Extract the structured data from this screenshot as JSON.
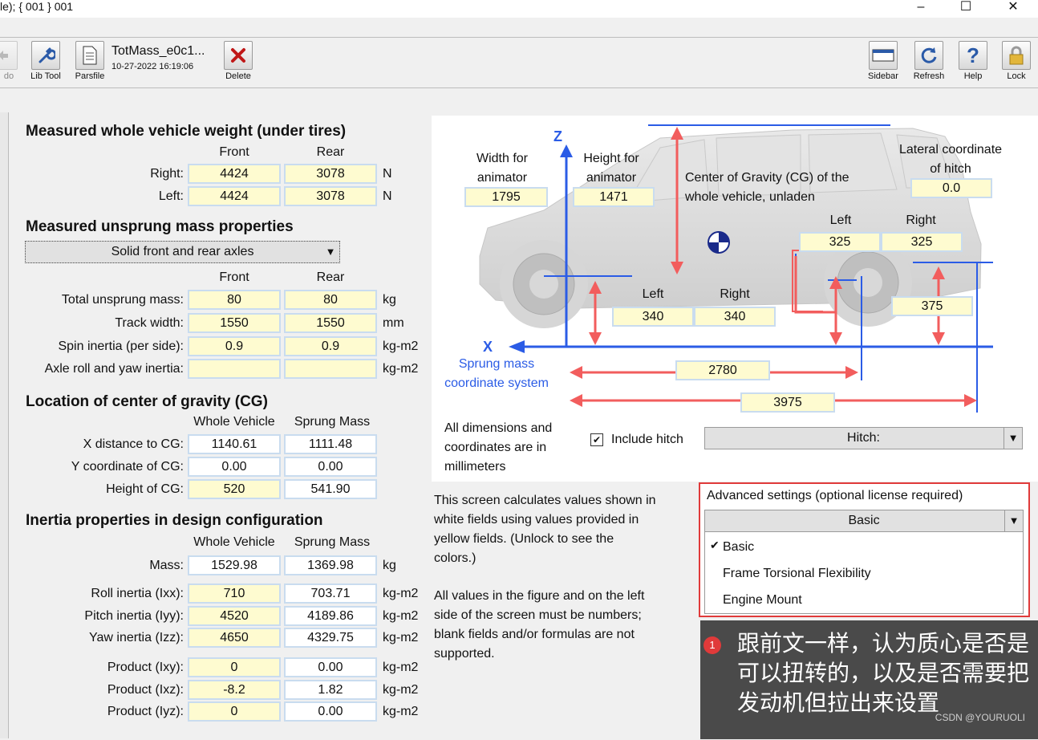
{
  "window": {
    "title": "le); { 001 } 001",
    "controls": [
      "–",
      "☐",
      "✕"
    ]
  },
  "toolbar": {
    "undo_label": "do",
    "lib_tool_label": "Lib Tool",
    "parsfile_label": "Parsfile",
    "dataset_name": "TotMass_e0c1...",
    "dataset_date": "10-27-2022 16:19:06",
    "delete_label": "Delete",
    "sidebar_label": "Sidebar",
    "refresh_label": "Refresh",
    "help_label": "Help",
    "lock_label": "Lock"
  },
  "weight": {
    "title": "Measured whole vehicle weight (under tires)",
    "col_front": "Front",
    "col_rear": "Rear",
    "right_label": "Right:",
    "left_label": "Left:",
    "right_front": "4424",
    "right_rear": "3078",
    "left_front": "4424",
    "left_rear": "3078",
    "unit": "N"
  },
  "unsprung": {
    "title": "Measured unsprung mass properties",
    "axle_option": "Solid front and rear axles",
    "col_front": "Front",
    "col_rear": "Rear",
    "rows": [
      {
        "label": "Total unsprung mass:",
        "front": "80",
        "rear": "80",
        "unit": "kg"
      },
      {
        "label": "Track width:",
        "front": "1550",
        "rear": "1550",
        "unit": "mm"
      },
      {
        "label": "Spin inertia (per side):",
        "front": "0.9",
        "rear": "0.9",
        "unit": "kg-m2"
      },
      {
        "label": "Axle roll and yaw inertia:",
        "front": "",
        "rear": "",
        "unit": "kg-m2"
      }
    ]
  },
  "cg": {
    "title": "Location of center of gravity (CG)",
    "col_whole": "Whole Vehicle",
    "col_sprung": "Sprung Mass",
    "rows": [
      {
        "label": "X distance  to CG:",
        "whole": "1140.61",
        "sprung": "1111.48"
      },
      {
        "label": "Y coordinate of CG:",
        "whole": "0.00",
        "sprung": "0.00"
      },
      {
        "label": "Height of CG:",
        "whole": "520",
        "sprung": "541.90"
      }
    ]
  },
  "inertia": {
    "title": "Inertia properties in design configuration",
    "col_whole": "Whole Vehicle",
    "col_sprung": "Sprung Mass",
    "mass": {
      "label": "Mass:",
      "whole": "1529.98",
      "sprung": "1369.98",
      "unit": "kg"
    },
    "rows1": [
      {
        "label": "Roll inertia (Ixx):",
        "whole": "710",
        "sprung": "703.71",
        "unit": "kg-m2"
      },
      {
        "label": "Pitch inertia (Iyy):",
        "whole": "4520",
        "sprung": "4189.86",
        "unit": "kg-m2"
      },
      {
        "label": "Yaw inertia (Izz):",
        "whole": "4650",
        "sprung": "4329.75",
        "unit": "kg-m2"
      }
    ],
    "rows2": [
      {
        "label": "Product (Ixy):",
        "whole": "0",
        "sprung": "0.00",
        "unit": "kg-m2"
      },
      {
        "label": "Product (Ixz):",
        "whole": "-8.2",
        "sprung": "1.82",
        "unit": "kg-m2"
      },
      {
        "label": "Product (Iyz):",
        "whole": "0",
        "sprung": "0.00",
        "unit": "kg-m2"
      }
    ]
  },
  "figure": {
    "z_axis": "Z",
    "x_axis": "X",
    "coord_label": "Sprung mass coordinate system",
    "width_label": "Width for animator",
    "width_value": "1795",
    "height_label": "Height for animator",
    "height_value": "1471",
    "cg_label": "Center of Gravity (CG) of the whole vehicle, unladen",
    "lateral_label": "Lateral coordinate of hitch",
    "lateral_value": "0.0",
    "hitch_left_label": "Left",
    "hitch_right_label": "Right",
    "hitch_left_value": "325",
    "hitch_right_value": "325",
    "front_left_label": "Left",
    "front_right_label": "Right",
    "front_left_value": "340",
    "front_right_value": "340",
    "hitch_height_value": "375",
    "wheelbase_value": "2780",
    "hitch_x_value": "3975",
    "dim_note": "All dimensions and coordinates are in millimeters",
    "include_hitch_label": "Include hitch",
    "hitch_select": "Hitch:"
  },
  "info": {
    "p1": "This screen calculates values shown in white fields using values provided in yellow fields. (Unlock to see the colors.)",
    "p2": "All values in the figure and on the left side of the screen must be numbers; blank fields and/or formulas are not supported."
  },
  "advanced": {
    "title": "Advanced settings (optional license required)",
    "selected": "Basic",
    "options": [
      "Basic",
      "Frame Torsional Flexibility",
      "Engine Mount"
    ]
  },
  "annotation": {
    "badge": "1",
    "text": "跟前文一样，认为质心是否是可以扭转的，以及是否需要把发动机但拉出来设置"
  },
  "watermark": "CSDN @YOURUOLI",
  "colors": {
    "yellow_field": "#fefbd0",
    "field_border": "#c9dcef",
    "arrow_red": "#f25d5d",
    "axis_blue": "#2b5ce6",
    "highlight_red": "#e03a3a"
  }
}
